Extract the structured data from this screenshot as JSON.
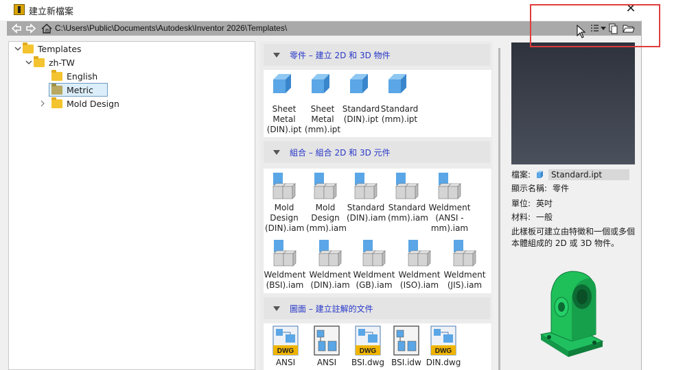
{
  "window": {
    "title": "建立新檔案"
  },
  "pathbar": {
    "path": "C:\\Users\\Public\\Documents\\Autodesk\\Inventor 2026\\Templates\\"
  },
  "tree": [
    {
      "label": "Templates",
      "level": 0,
      "expanded": true
    },
    {
      "label": "zh-TW",
      "level": 1,
      "expanded": true
    },
    {
      "label": "English",
      "level": 2
    },
    {
      "label": "Metric",
      "level": 2,
      "selected": true
    },
    {
      "label": "Mold Design",
      "level": 2,
      "collapsed": true
    }
  ],
  "sections": {
    "parts": {
      "title": "零件 – 建立 2D 和 3D 物件",
      "items": [
        {
          "label": "Sheet\nMetal\n(DIN).ipt",
          "icon": "part-icon"
        },
        {
          "label": "Sheet\nMetal\n(mm).ipt",
          "icon": "part-icon"
        },
        {
          "label": "Standard\n(DIN).ipt",
          "icon": "part-icon"
        },
        {
          "label": "Standard\n(mm).ipt",
          "icon": "part-icon"
        }
      ]
    },
    "assemblies": {
      "title": "組合 – 組合 2D 和 3D 元件",
      "items": [
        {
          "label": "Mold\nDesign\n(DIN).iam",
          "icon": "assembly-icon"
        },
        {
          "label": "Mold\nDesign\n(mm).iam",
          "icon": "assembly-icon"
        },
        {
          "label": "Standard\n(DIN).iam",
          "icon": "assembly-icon"
        },
        {
          "label": "Standard\n(mm).iam",
          "icon": "assembly-icon"
        },
        {
          "label": "Weldment\n(ANSI -\nmm).iam",
          "icon": "assembly-icon"
        },
        {
          "label": "Weldment\n(BSI).iam",
          "icon": "assembly-icon"
        },
        {
          "label": "Weldment\n(DIN).iam",
          "icon": "assembly-icon"
        },
        {
          "label": "Weldment\n(GB).iam",
          "icon": "assembly-icon"
        },
        {
          "label": "Weldment\n(ISO).iam",
          "icon": "assembly-icon"
        },
        {
          "label": "Weldment\n(JIS).iam",
          "icon": "assembly-icon"
        }
      ]
    },
    "drawings": {
      "title": "圖面 – 建立註解的文件",
      "items": [
        {
          "label": "ANSI",
          "icon": "dwg-icon"
        },
        {
          "label": "ANSI",
          "icon": "idw-icon"
        },
        {
          "label": "BSI.dwg",
          "icon": "dwg-icon"
        },
        {
          "label": "BSI.idw",
          "icon": "idw-icon"
        },
        {
          "label": "DIN.dwg",
          "icon": "dwg-icon"
        }
      ]
    }
  },
  "info": {
    "file_key": "檔案:",
    "file_value": "Standard.ipt",
    "display_key": "顯示名稱:",
    "display_value": "零件",
    "unit_key": "單位:",
    "unit_value": "英吋",
    "material_key": "材料:",
    "material_value": "一般",
    "description": "此樣板可建立由特徵和一個或多個本體組成的 2D 或 3D 物件。"
  },
  "icons": {
    "dwg_badge": "DWG"
  },
  "colors": {
    "annotation": "#e03c3c",
    "section_title": "#2838c8",
    "part_blue": "#5aa6e6",
    "model_green": "#1fbf5a"
  }
}
